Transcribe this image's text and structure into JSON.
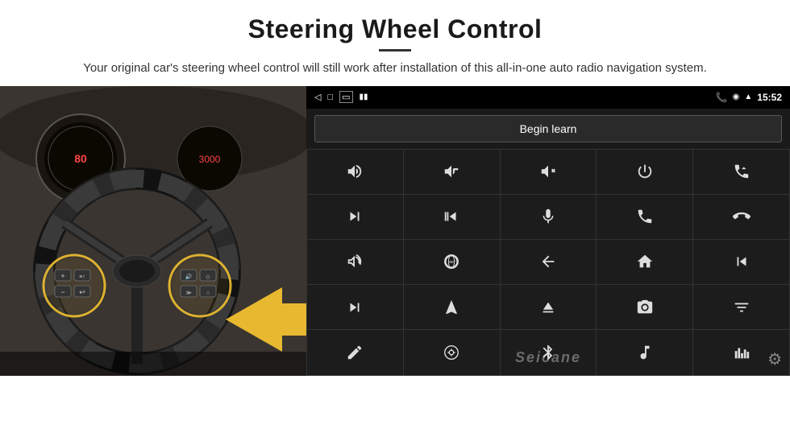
{
  "header": {
    "title": "Steering Wheel Control",
    "subtitle": "Your original car's steering wheel control will still work after installation of this all-in-one auto radio navigation system."
  },
  "status_bar": {
    "time": "15:52",
    "back_icon": "◁",
    "home_icon": "□",
    "recents_icon": "▭",
    "signal_icon": "▮▮▮",
    "phone_icon": "📞",
    "location_icon": "📍",
    "wifi_icon": "📶"
  },
  "begin_learn": {
    "label": "Begin learn"
  },
  "controls": {
    "rows": [
      [
        "vol+",
        "vol-",
        "mute",
        "power",
        "prev-track"
      ],
      [
        "next",
        "ff-back",
        "mic",
        "phone",
        "hang-up"
      ],
      [
        "horn",
        "360-cam",
        "back",
        "home",
        "skip-back"
      ],
      [
        "skip-fwd",
        "nav",
        "eject",
        "camera2",
        "equalizer"
      ],
      [
        "pen",
        "settings2",
        "bluetooth",
        "music",
        "spectrum"
      ]
    ]
  },
  "watermark": {
    "text": "Seicane"
  }
}
